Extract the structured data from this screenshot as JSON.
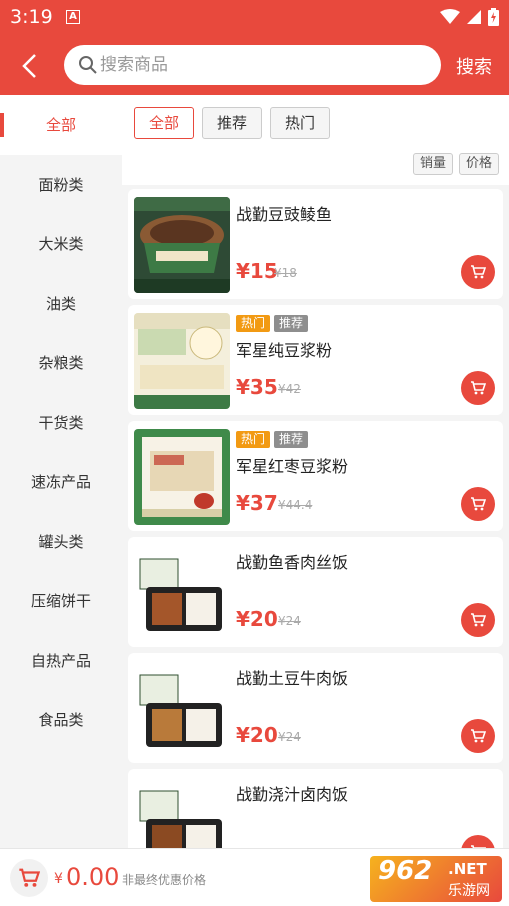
{
  "status_bar": {
    "time": "3:19",
    "notif_letter": "A"
  },
  "header": {
    "search_placeholder": "搜索商品",
    "search_button": "搜索"
  },
  "sidebar": {
    "items": [
      "全部",
      "面粉类",
      "大米类",
      "油类",
      "杂粮类",
      "干货类",
      "速冻产品",
      "罐头类",
      "压缩饼干",
      "自热产品",
      "食品类"
    ],
    "active_index": 0
  },
  "tabs": [
    "全部",
    "推荐",
    "热门"
  ],
  "sorts": [
    "销量",
    "价格"
  ],
  "products": [
    {
      "title": "战勤豆豉鲮鱼",
      "tags": [],
      "price": "¥15",
      "old_price": "¥18"
    },
    {
      "title": "军星纯豆浆粉",
      "tags": [
        "热门",
        "推荐"
      ],
      "price": "¥35",
      "old_price": "¥42"
    },
    {
      "title": "军星红枣豆浆粉",
      "tags": [
        "热门",
        "推荐"
      ],
      "price": "¥37",
      "old_price": "¥44.4"
    },
    {
      "title": "战勤鱼香肉丝饭",
      "tags": [],
      "price": "¥20",
      "old_price": "¥24"
    },
    {
      "title": "战勤土豆牛肉饭",
      "tags": [],
      "price": "¥20",
      "old_price": "¥24"
    },
    {
      "title": "战勤浇汁卤肉饭",
      "tags": [],
      "price": "",
      "old_price": ""
    }
  ],
  "bottom": {
    "currency": "¥",
    "total": "0.00",
    "note": "非最终优惠价格"
  },
  "watermark": {
    "num": "962",
    "net": ".NET",
    "cn": "乐游网"
  },
  "colors": {
    "accent": "#e8493d",
    "hot_tag": "#f29a13",
    "rec_tag": "#8e8e8e"
  }
}
